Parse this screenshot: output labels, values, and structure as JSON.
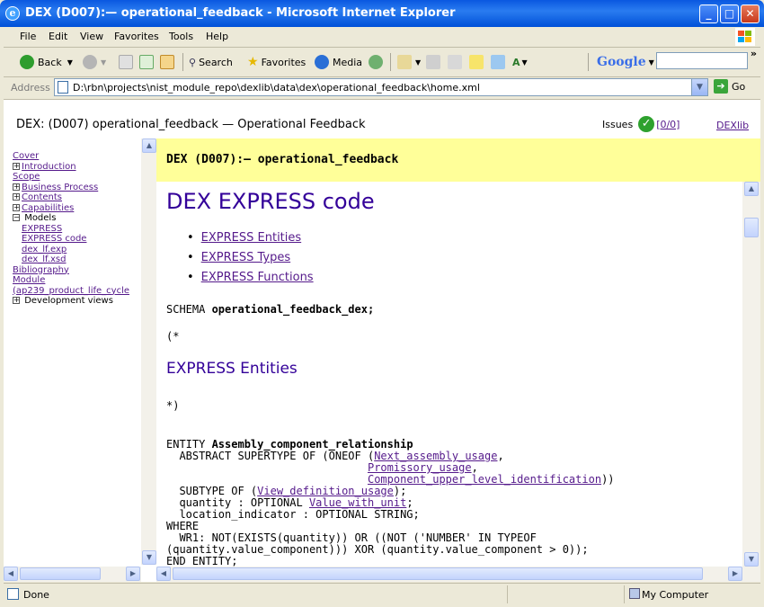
{
  "window": {
    "title": "DEX (D007):— operational_feedback - Microsoft Internet Explorer",
    "minimize": "_",
    "maximize": "□",
    "close": "✕"
  },
  "menu": [
    "File",
    "Edit",
    "View",
    "Favorites",
    "Tools",
    "Help"
  ],
  "toolbar": {
    "back": "Back",
    "search": "Search",
    "favorites": "Favorites",
    "media": "Media",
    "google": "Google"
  },
  "address": {
    "label": "Address",
    "url": "D:\\rbn\\projects\\nist_module_repo\\dexlib\\data\\dex\\operational_feedback\\home.xml",
    "go": "Go"
  },
  "page": {
    "header": "DEX: (D007) operational_feedback — Operational Feedback",
    "issues_label": "Issues",
    "issues_count": "[0/0]",
    "dexlib": "DEXlib"
  },
  "toc": [
    {
      "label": "Cover",
      "link": true,
      "expander": false,
      "indent": 0
    },
    {
      "label": "Introduction",
      "link": true,
      "expander": true,
      "indent": 0
    },
    {
      "label": "Scope",
      "link": true,
      "expander": false,
      "indent": 0
    },
    {
      "label": "Business Process",
      "link": true,
      "expander": true,
      "indent": 0
    },
    {
      "label": "Contents",
      "link": true,
      "expander": true,
      "indent": 0
    },
    {
      "label": "Capabilities",
      "link": true,
      "expander": true,
      "indent": 0
    },
    {
      "label": "Models",
      "link": false,
      "expander": true,
      "expanded": true,
      "indent": 0
    },
    {
      "label": "EXPRESS",
      "link": true,
      "expander": false,
      "indent": 1
    },
    {
      "label": "EXPRESS code",
      "link": true,
      "expander": false,
      "indent": 1
    },
    {
      "label": "dex_lf.exp",
      "link": true,
      "expander": false,
      "indent": 1
    },
    {
      "label": "dex_lf.xsd",
      "link": true,
      "expander": false,
      "indent": 1
    },
    {
      "label": "Bibliography",
      "link": true,
      "expander": false,
      "indent": 0
    },
    {
      "label": "Module",
      "link": true,
      "expander": false,
      "indent": 0
    },
    {
      "label": "(ap239_product_life_cycle",
      "link": true,
      "expander": false,
      "indent": 0
    },
    {
      "label": "Development views",
      "link": false,
      "expander": true,
      "indent": 0
    }
  ],
  "main": {
    "banner": "DEX (D007):— operational_feedback",
    "heading": "DEX EXPRESS code",
    "links": [
      "EXPRESS Entities",
      "EXPRESS Types",
      "EXPRESS Functions"
    ],
    "schema_kw": "SCHEMA ",
    "schema_name": "operational_feedback_dex;",
    "comment_open": "(*",
    "section": "EXPRESS Entities",
    "comment_close": "*)",
    "entity_kw": "ENTITY ",
    "entity_name": "Assembly_component_relationship",
    "abstract_line": "  ABSTRACT SUPERTYPE OF (ONEOF (",
    "super1": "Next_assembly_usage",
    "super2": "Promissory_usage",
    "super3": "Component_upper_level_identification",
    "subtype_line": "  SUBTYPE OF (",
    "subtype_ref": "View_definition_usage",
    "quantity_line": "  quantity : OPTIONAL ",
    "quantity_ref": "Value_with_unit",
    "location_line": "  location_indicator : OPTIONAL STRING;",
    "where_line": "WHERE",
    "wr1_line": "  WR1: NOT(EXISTS(quantity)) OR ((NOT ('NUMBER' IN TYPEOF",
    "wr1_cont": "(quantity.value_component))) XOR (quantity.value_component > 0));",
    "end_line": "END_ENTITY;"
  },
  "status": {
    "done": "Done",
    "zone": "My Computer"
  }
}
